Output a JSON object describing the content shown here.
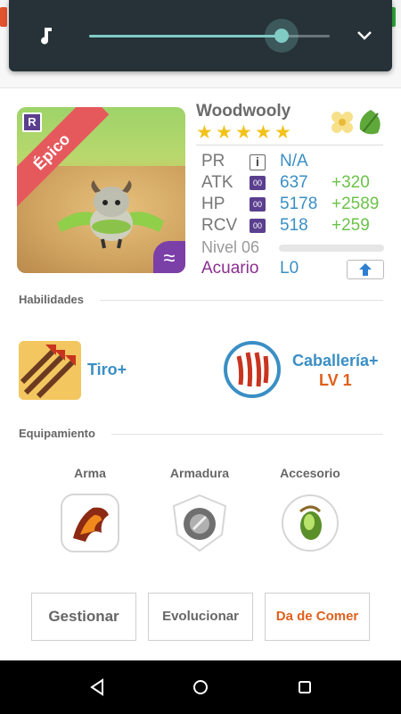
{
  "colors": {
    "accent": "#80cbc4",
    "stat_blue": "#3a8fc4",
    "bonus_green": "#6cc24a",
    "sign_purple": "#8a2e8f",
    "skill_orange": "#e05f1b"
  },
  "volume": {
    "icon": "music-note-icon",
    "level_percent": 80,
    "collapse_icon": "chevron-down-icon"
  },
  "character": {
    "name": "Woodwooly",
    "rarity": "Épico",
    "rarity_badge": "R",
    "element_symbol": "≈",
    "stars": 5,
    "star_glyph": "★",
    "element_icons": [
      "flower-icon",
      "leaf-icon"
    ],
    "stats": [
      {
        "label": "PR",
        "badge": "i",
        "value": "N/A",
        "bonus": ""
      },
      {
        "label": "ATK",
        "badge": "00",
        "value": "637",
        "bonus": "+320"
      },
      {
        "label": "HP",
        "badge": "00",
        "value": "5178",
        "bonus": "+2589"
      },
      {
        "label": "RCV",
        "badge": "00",
        "value": "518",
        "bonus": "+259"
      }
    ],
    "level_label": "Nivel 06",
    "level_progress": 0,
    "sign": "Acuario",
    "sign_level": "L0"
  },
  "skills": {
    "title": "Habilidades",
    "items": [
      {
        "name": "Tiro+",
        "level": ""
      },
      {
        "name": "Caballería+",
        "level": "LV 1"
      }
    ]
  },
  "equipment": {
    "title": "Equipamiento",
    "slots": [
      {
        "label": "Arma"
      },
      {
        "label": "Armadura"
      },
      {
        "label": "Accesorio"
      }
    ]
  },
  "actions": {
    "manage": "Gestionar",
    "evolve": "Evolucionar",
    "feed": "Da de Comer"
  }
}
